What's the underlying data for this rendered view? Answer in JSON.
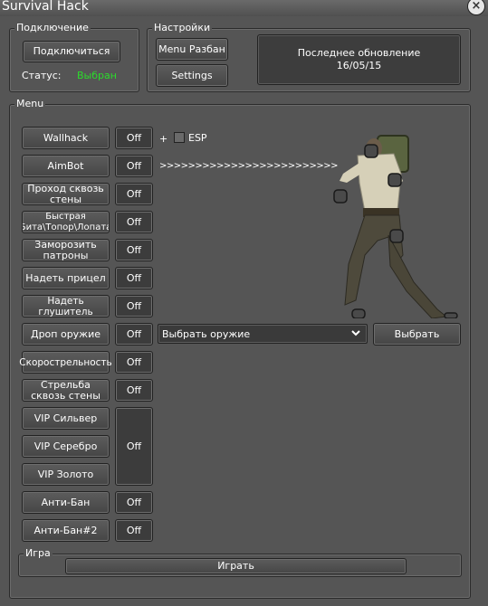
{
  "window": {
    "title": "Survival Hack",
    "close_glyph": "×"
  },
  "connection": {
    "group_title": "Подключение",
    "connect_label": "Подключиться",
    "status_label": "Статус:",
    "status_value": "Выбран"
  },
  "settings": {
    "group_title": "Настройки",
    "menu_unban_label": "Menu Разбан",
    "settings_label": "Settings"
  },
  "update": {
    "line1": "Последнее обновление",
    "line2": "16/05/15"
  },
  "menu": {
    "group_title": "Menu",
    "items": [
      {
        "label": "Wallhack",
        "toggle": "Off"
      },
      {
        "label": "AimBot",
        "toggle": "Off"
      },
      {
        "label": "Проход сквозь стены",
        "toggle": "Off"
      },
      {
        "label": "Быстрая Бита\\Топор\\Лопата",
        "toggle": "Off"
      },
      {
        "label": "Заморозить патроны",
        "toggle": "Off"
      },
      {
        "label": "Надеть прицел",
        "toggle": "Off"
      },
      {
        "label": "Надеть глушитель",
        "toggle": "Off"
      },
      {
        "label": "Дроп оружие",
        "toggle": "Off"
      },
      {
        "label": "Скорострельность",
        "toggle": "Off"
      },
      {
        "label": "Стрельба сквозь стены",
        "toggle": "Off"
      },
      {
        "label": "VIP Сильвер"
      },
      {
        "label": "VIP Серебро"
      },
      {
        "label": "VIP Золото"
      },
      {
        "label": "Анти-Бан",
        "toggle": "Off"
      },
      {
        "label": "Анти-Бан#2",
        "toggle": "Off"
      }
    ],
    "vip_toggle": "Off",
    "plus": "+",
    "esp_label": "ESP",
    "aim_arrows": ">>>>>>>>>>>>>>>>>>>>>>>>>",
    "weapon_select_value": "Выбрать оружие",
    "weapon_choose_label": "Выбрать"
  },
  "game": {
    "group_title": "Игра",
    "play_label": "Играть"
  },
  "icons": {
    "close": "close-icon",
    "dropdown": "chevron-down-icon",
    "checkbox": "checkbox-icon"
  }
}
